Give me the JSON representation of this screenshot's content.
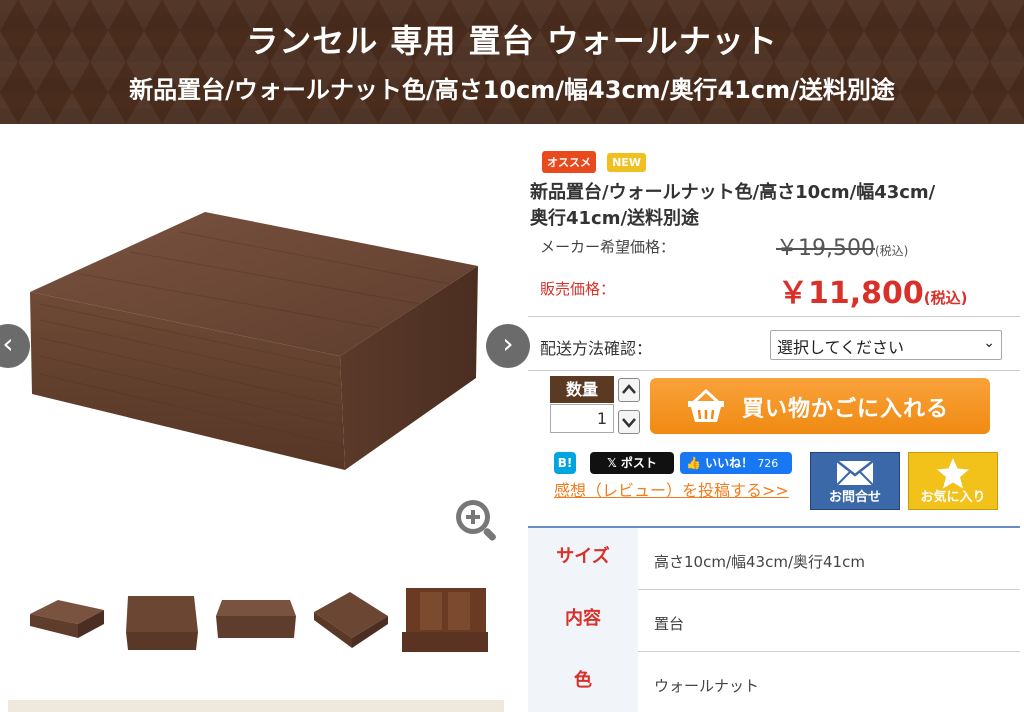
{
  "header": {
    "title": "ランセル 専用 置台 ウォールナット",
    "subtitle": "新品置台/ウォールナット色/高さ10cm/幅43cm/奥行41cm/送料別途"
  },
  "gallery": {
    "prev_glyph": "‹",
    "next_glyph": "›",
    "thumbnail_count": 5
  },
  "product": {
    "badges": [
      "オススメ",
      "NEW"
    ],
    "title_line1": "新品置台/ウォールナット色/高さ10cm/幅43cm/",
    "title_line2": "奥行41cm/送料別途",
    "list_price_label": "メーカー希望価格：",
    "list_price": "￥19,500",
    "list_price_tax": "(税込)",
    "sale_price_label": "販売価格：",
    "sale_price": "￥11,800",
    "sale_price_tax": "(税込)"
  },
  "shipping": {
    "label": "配送方法確認：",
    "selected": "選択してください",
    "arrow": "⌄"
  },
  "quantity": {
    "label": "数量",
    "value": "1"
  },
  "cart": {
    "label": "買い物かごに入れる"
  },
  "share": {
    "hatena": "B!",
    "x_post": "𝕏 ポスト",
    "fb_like": "👍 いいね！",
    "fb_count": "726",
    "review_link": "感想（レビュー）を投稿する>>"
  },
  "actions": {
    "contact": "お問合せ",
    "favorite": "お気に入り"
  },
  "specs": [
    {
      "label": "サイズ",
      "value": "高さ10cm/幅43cm/奥行41cm"
    },
    {
      "label": "内容",
      "value": "置台"
    },
    {
      "label": "色",
      "value": "ウォールナット"
    }
  ],
  "colors": {
    "header_bg": "#4a2c1c",
    "sale_red": "#d9302a",
    "cart_orange": "#f08a12",
    "contact_blue": "#3b68a8",
    "favorite_yellow": "#f2c21a",
    "wood": "#6b4632"
  }
}
